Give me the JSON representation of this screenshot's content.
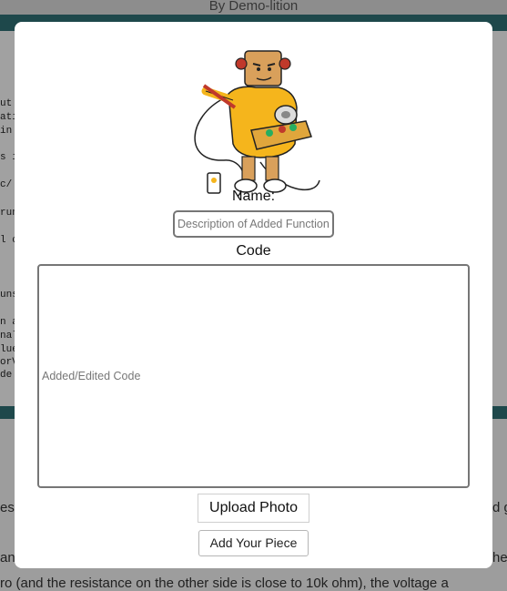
{
  "background": {
    "header_text": "By Demo-lition",
    "code_fragments": [
      "ut",
      "ati",
      "in",
      "s i",
      "c/",
      "run",
      "l c",
      "uns",
      "n a",
      "nal",
      "lue",
      "orV",
      "de"
    ],
    "bottom_lines": [
      "es",
      "d g",
      "an",
      "he",
      "ro (and the resistance on the other side is close to 10k ohm), the voltage a"
    ]
  },
  "modal": {
    "name_label": "Name:",
    "name_placeholder": "Description of Added Function",
    "code_label": "Code",
    "code_placeholder": "Added/Edited Code",
    "upload_button": "Upload Photo",
    "submit_button": "Add Your Piece"
  },
  "colors": {
    "accent_bar": "#2f6f73",
    "mascot_body": "#f5b51c"
  },
  "icons": {
    "mascot": "robot-mascot-illustration"
  }
}
